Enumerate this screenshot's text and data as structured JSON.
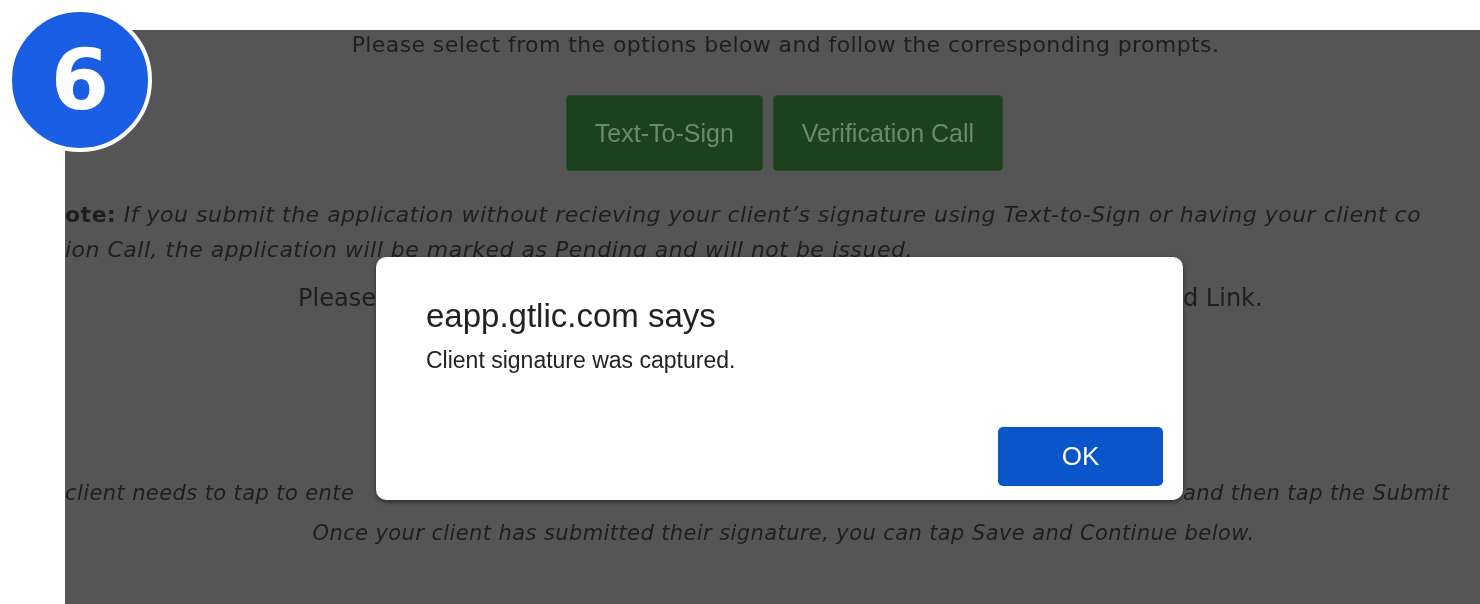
{
  "step_badge": "6",
  "instructions": "Please select from the options below and follow the corresponding prompts.",
  "option_buttons": [
    "Text-To-Sign",
    "Verification Call"
  ],
  "note_lines": [
    "**ote:** If you submit the application without recieving your client’s signature using Text-to-Sign or having your client co",
    "ion Call, the application will be marked as Pending and will not be issued."
  ],
  "link_line": {
    "left": "Please",
    "right": "d Link."
  },
  "tap_line": {
    "left": "client needs to tap to ente",
    "right": "and then tap the Submit"
  },
  "closing_line": "Once your client has submitted their signature, you can tap Save and Continue below.",
  "dialog": {
    "title": "eapp.gtlic.com says",
    "message": "Client signature was captured.",
    "button": "OK"
  }
}
